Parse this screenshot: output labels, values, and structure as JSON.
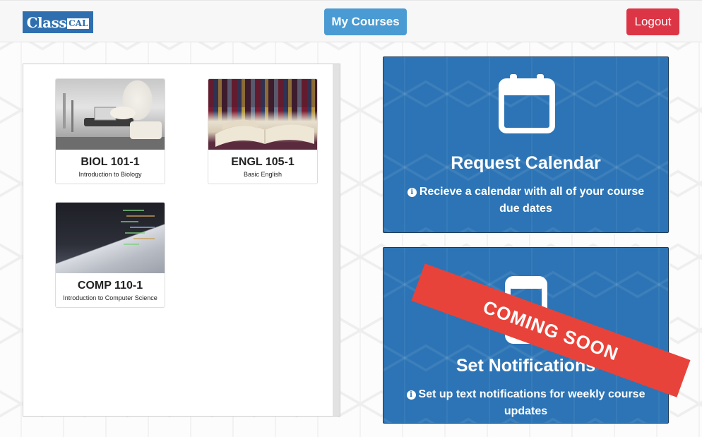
{
  "navbar": {
    "logo_text_main": "Class",
    "logo_text_box": "CAL",
    "courses_button": "My Courses",
    "logout_button": "Logout"
  },
  "courses": [
    {
      "code": "BIOL 101-1",
      "name": "Introduction to Biology",
      "image": "laboratory-photo"
    },
    {
      "code": "ENGL 105-1",
      "name": "Basic English",
      "image": "open-book-photo"
    },
    {
      "code": "COMP 110-1",
      "name": "Introduction to Computer Science",
      "image": "laptop-code-photo"
    }
  ],
  "actions": {
    "calendar": {
      "icon": "calendar-icon",
      "title": "Request Calendar",
      "description": "Recieve a calendar with all of your course due dates"
    },
    "notifications": {
      "icon": "mobile-phone-icon",
      "title": "Set Notifications",
      "description": "Set up text notifications for weekly course updates",
      "ribbon": "COMING SOON"
    }
  },
  "colors": {
    "brand": "#2f6fb0",
    "primary_button": "#4a9bd3",
    "danger_button": "#dc3545",
    "card_blue": "#2c74b5",
    "ribbon_red": "#e8433a"
  }
}
